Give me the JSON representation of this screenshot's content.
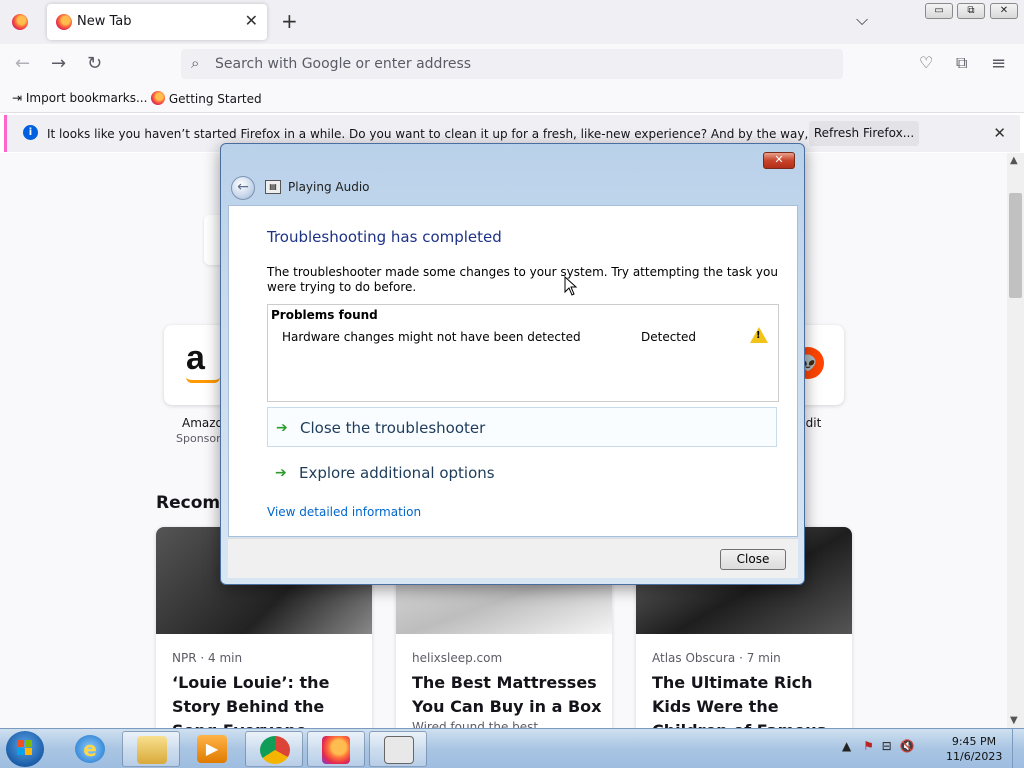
{
  "browser": {
    "tab": {
      "label": "New Tab",
      "close": "✕"
    },
    "new_tab": "+",
    "tab_list": "⌵",
    "window_buttons": {
      "minimize": "▭",
      "restore": "⧉",
      "close": "✕"
    },
    "urlbar": {
      "placeholder": "Search with Google or enter address"
    },
    "bookmarks": [
      {
        "label": "Import bookmarks..."
      },
      {
        "label": "Getting Started"
      }
    ],
    "notification": {
      "message": "It looks like you haven’t started Firefox in a while. Do you want to clean it up for a fresh, like-new experience? And by the way, welcome back!",
      "button": "Refresh Firefox...",
      "close": "✕"
    }
  },
  "newtab": {
    "shortcuts": [
      {
        "label": "Amazo",
        "sub": "Sponsor",
        "glyph": "a"
      },
      {
        "label": "ddit",
        "sub": "",
        "glyph": "👽"
      }
    ],
    "recommended_heading": "Recomm",
    "cards": [
      {
        "source": "NPR · 4 min",
        "title": "‘Louie Louie’: the Story Behind the Song Everyone Knows but",
        "snippet": ""
      },
      {
        "source": "helixsleep.com",
        "title": "The Best Mattresses You Can Buy in a Box",
        "snippet": "Wired found the best"
      },
      {
        "source": "Atlas Obscura · 7 min",
        "title": "The Ultimate Rich Kids Were the Children of Famous Explorers",
        "snippet": ""
      }
    ]
  },
  "dialog": {
    "title": "Playing Audio",
    "close_glyph": "✕",
    "heading": "Troubleshooting has completed",
    "description": "The troubleshooter made some changes to your system. Try attempting the task you were trying to do before.",
    "problems_header": "Problems found",
    "problems": [
      {
        "name": "Hardware changes might not have been detected",
        "status": "Detected",
        "icon": "warning-icon"
      }
    ],
    "commands": [
      {
        "label": "Close the troubleshooter"
      },
      {
        "label": "Explore additional options"
      }
    ],
    "detail_link": "View detailed information",
    "close_button": "Close"
  },
  "taskbar": {
    "clock_time": "9:45 PM",
    "clock_date": "11/6/2023"
  },
  "colors": {
    "notification_accent": "#ff66cc",
    "dialog_heading": "#1e3287",
    "link": "#0066cc",
    "command_arrow": "#2e9b2e"
  }
}
